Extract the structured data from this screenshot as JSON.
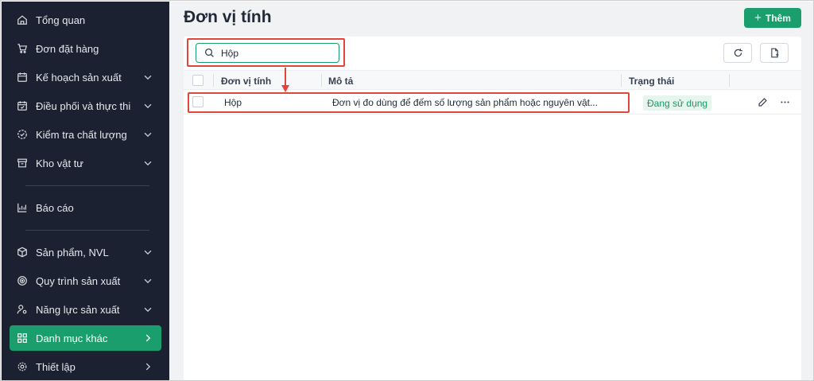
{
  "sidebar": {
    "items": [
      {
        "label": "Tổng quan",
        "icon": "home-icon"
      },
      {
        "label": "Đơn đặt hàng",
        "icon": "cart-icon"
      },
      {
        "label": "Kế hoạch sản xuất",
        "icon": "calendar-icon"
      },
      {
        "label": "Điều phối và thực thi",
        "icon": "calendar-check-icon"
      },
      {
        "label": "Kiểm tra chất lượng",
        "icon": "check-circle-icon"
      },
      {
        "label": "Kho vật tư",
        "icon": "archive-icon"
      },
      {
        "label": "Báo cáo",
        "icon": "chart-icon"
      },
      {
        "label": "Sản phẩm, NVL",
        "icon": "cube-icon"
      },
      {
        "label": "Quy trình sản xuất",
        "icon": "process-icon"
      },
      {
        "label": "Năng lực sản xuất",
        "icon": "user-gear-icon"
      },
      {
        "label": "Danh mục khác",
        "icon": "grid-icon",
        "active": true
      },
      {
        "label": "Thiết lập",
        "icon": "gear-icon"
      }
    ]
  },
  "header": {
    "title": "Đơn vị tính",
    "add_label": "Thêm"
  },
  "search": {
    "value": "Hộp"
  },
  "table": {
    "columns": [
      "Đơn vị tính",
      "Mô tả",
      "Trạng thái"
    ],
    "rows": [
      {
        "unit": "Hộp",
        "description": "Đơn vị đo dùng để đếm số lượng sản phẩm hoặc nguyên vật...",
        "status": "Đang sử dụng"
      }
    ]
  },
  "colors": {
    "accent": "#1a9e6e",
    "sidebar_bg": "#1b2130",
    "highlight": "#e0463b",
    "status_bg": "#e6f6ee"
  }
}
